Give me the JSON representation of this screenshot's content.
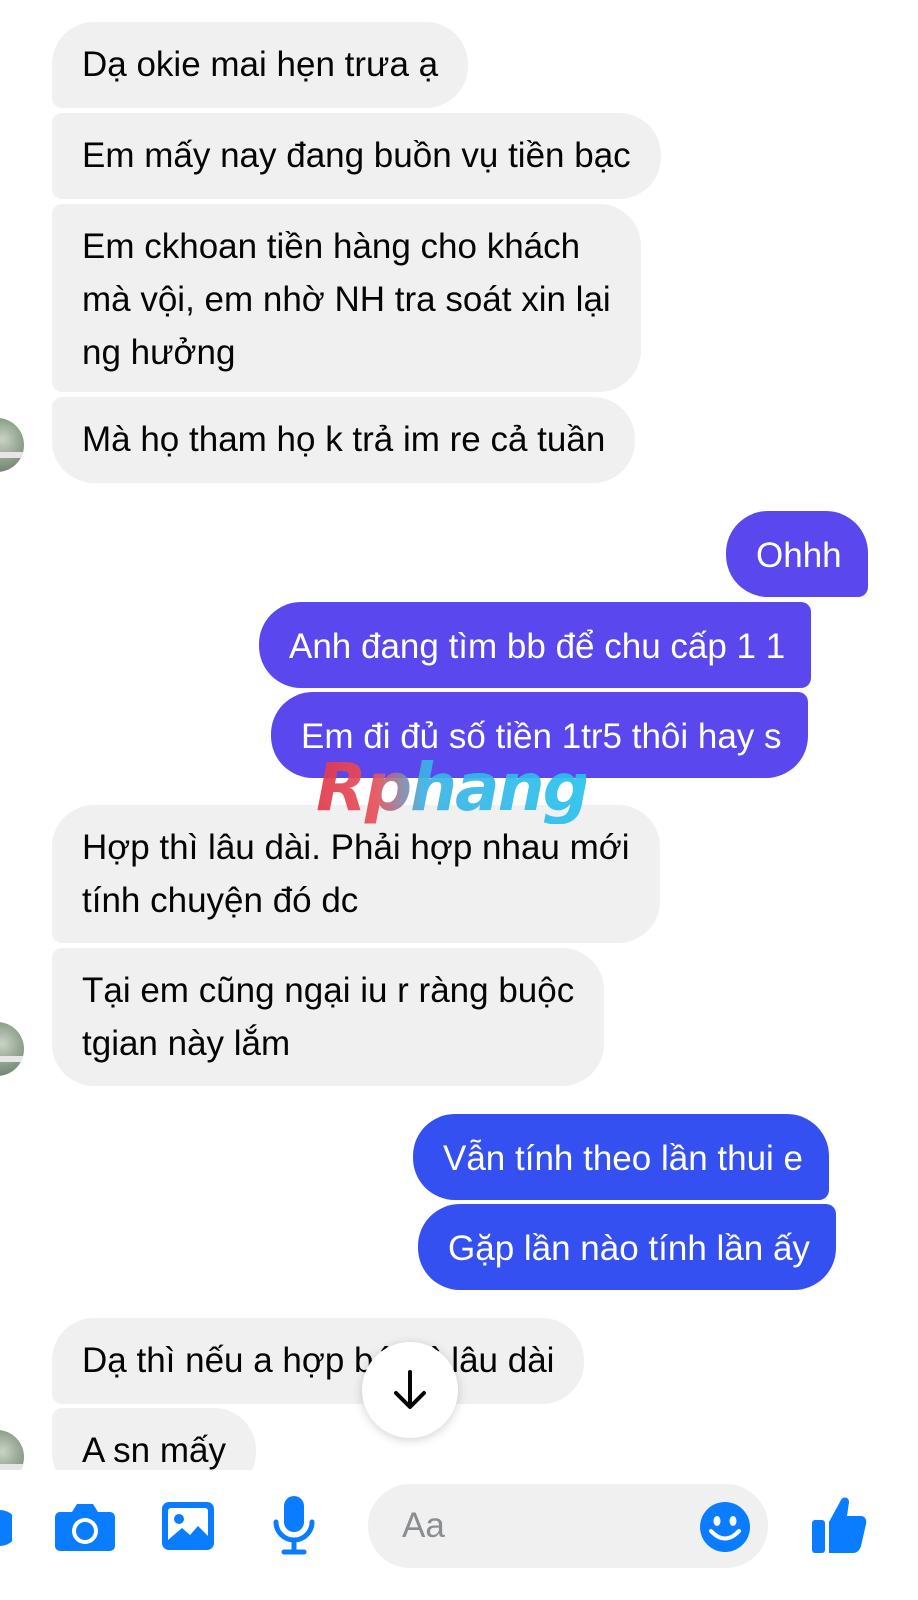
{
  "messages": [
    {
      "text": "Dạ okie mai hẹn trưa ạ"
    },
    {
      "text": "Em mấy nay đang buồn vụ tiền bạc"
    },
    {
      "text": "Em ckhoan tiền hàng cho khách\nmà vội, em nhờ NH tra soát xin lại\nng hưởng"
    },
    {
      "text": "Mà họ tham họ k trả im re cả tuần"
    },
    {
      "text": "Ohhh"
    },
    {
      "text": "Anh đang tìm bb để chu cấp 1 1"
    },
    {
      "text": "Em đi đủ số tiền 1tr5 thôi hay s"
    },
    {
      "text": "Hợp thì lâu dài. Phải hợp nhau mới\ntính chuyện đó dc"
    },
    {
      "text": "Tại em cũng ngại iu r ràng buộc\ntgian này lắm"
    },
    {
      "text": "Vẫn tính theo lần thui e"
    },
    {
      "text": "Gặp lần nào tính lần ấy"
    },
    {
      "text": "Dạ thì nếu a hợp bé thì lâu dài"
    },
    {
      "text": "A sn mấy"
    }
  ],
  "watermark": "Rphang",
  "composer": {
    "placeholder": "Aa"
  },
  "colors": {
    "incoming_bubble": "#f0f0f0",
    "outgoing_bubble_purple": "#5b47ee",
    "outgoing_bubble_blue": "#3550f0",
    "icon_blue": "#0a7cff"
  },
  "icons": [
    "camera-icon",
    "image-icon",
    "microphone-icon",
    "emoji-icon",
    "like-icon",
    "arrow-down-icon"
  ]
}
